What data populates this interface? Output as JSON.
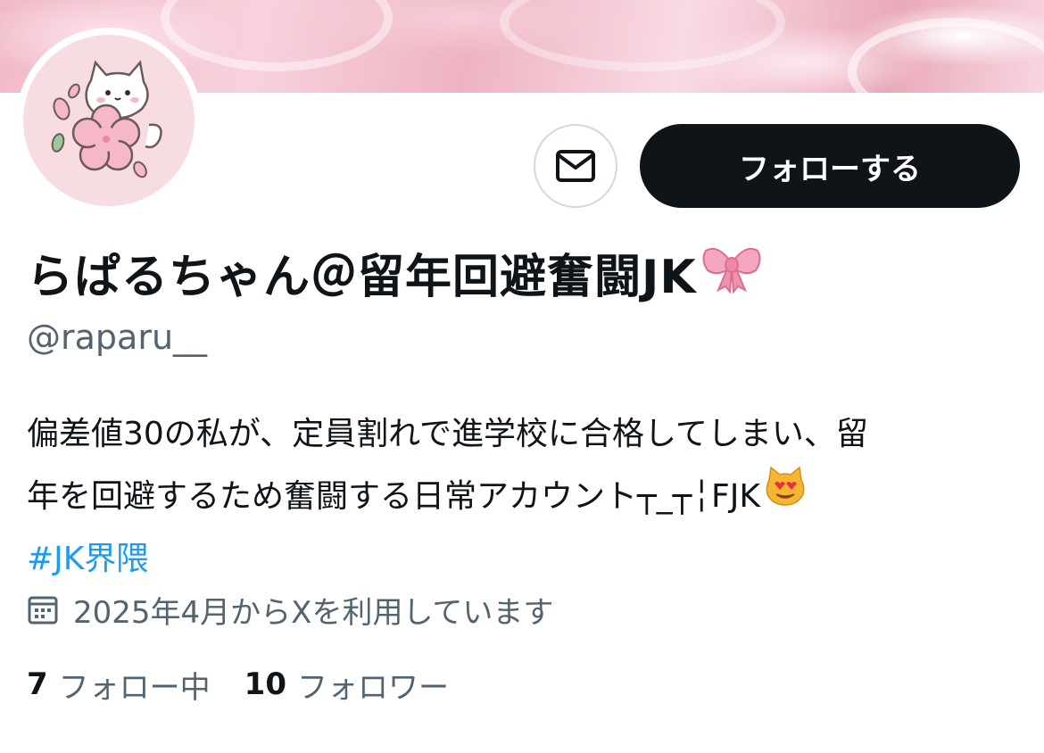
{
  "profile": {
    "display_name": "らぱるちゃん＠留年回避奮闘JK",
    "display_name_emoji": "ribbon-emoji",
    "handle": "@raparu__",
    "bio_line1": "偏差値30の私が、定員割れで進学校に合格してしまい、留",
    "bio_line2": "年を回避するため奮闘する日常アカウント┬_┬╎FJK",
    "bio_emoji": "heart-eyes-cat-emoji",
    "hashtag": "#JK界隈",
    "joined": "2025年4月からXを利用しています",
    "following_count": "7",
    "following_label": "フォロー中",
    "followers_count": "10",
    "followers_label": "フォロワー"
  },
  "actions": {
    "follow_label": "フォローする",
    "message_icon": "mail-icon"
  },
  "colors": {
    "text_primary": "#0f1419",
    "text_secondary": "#536471",
    "link": "#1d9bf0",
    "button_dark": "#0f1419",
    "avatar_bg": "#f7dde2",
    "banner_pink": "#f1b9c7"
  }
}
